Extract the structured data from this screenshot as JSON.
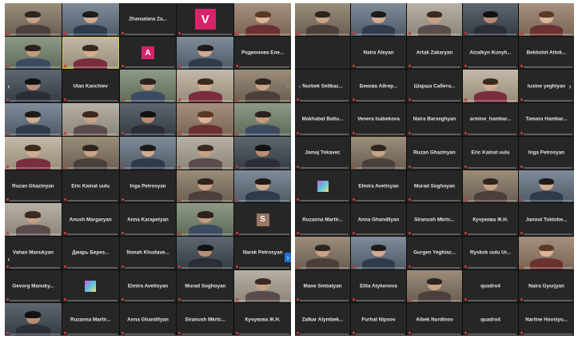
{
  "left_panel": {
    "tiles": [
      {
        "type": "video"
      },
      {
        "type": "video"
      },
      {
        "type": "name",
        "name": "Zhanadana Za..."
      },
      {
        "type": "avatar",
        "letter": "V",
        "color": "#d6246a",
        "big": true
      },
      {
        "type": "video"
      },
      {
        "type": "video"
      },
      {
        "type": "video",
        "active": true
      },
      {
        "type": "avatar",
        "letter": "A",
        "color": "#d6246a"
      },
      {
        "type": "video"
      },
      {
        "type": "name",
        "name": "Родионова Еле..."
      },
      {
        "type": "video"
      },
      {
        "type": "name",
        "name": "Ulan Kanchiev"
      },
      {
        "type": "video"
      },
      {
        "type": "video"
      },
      {
        "type": "video"
      },
      {
        "type": "video"
      },
      {
        "type": "video"
      },
      {
        "type": "video"
      },
      {
        "type": "video"
      },
      {
        "type": "video"
      },
      {
        "type": "video"
      },
      {
        "type": "video"
      },
      {
        "type": "video"
      },
      {
        "type": "video"
      },
      {
        "type": "video"
      },
      {
        "type": "name",
        "name": "Ruzan Ghazinyan"
      },
      {
        "type": "name",
        "name": "Eric Kainat uulu"
      },
      {
        "type": "name",
        "name": "Inga Petrosyan"
      },
      {
        "type": "video"
      },
      {
        "type": "video"
      },
      {
        "type": "video"
      },
      {
        "type": "name",
        "name": "Anush Margaryan"
      },
      {
        "type": "name",
        "name": "Anna Karapetyan"
      },
      {
        "type": "video"
      },
      {
        "type": "avatar",
        "letter": "S",
        "color": "#9a7666"
      },
      {
        "type": "name",
        "name": "Vahan Manukyan"
      },
      {
        "type": "name",
        "name": "Дмарь Берез..."
      },
      {
        "type": "name",
        "name": "Nonah Khudave..."
      },
      {
        "type": "video"
      },
      {
        "type": "name",
        "name": "Narek Petrosyan"
      },
      {
        "type": "name",
        "name": "Gevorg Manuky..."
      },
      {
        "type": "logo"
      },
      {
        "type": "name",
        "name": "Elmira Avetisyan"
      },
      {
        "type": "name",
        "name": "Murad Soghoyan"
      },
      {
        "type": "video"
      },
      {
        "type": "video"
      },
      {
        "type": "name",
        "name": "Ruzanna Martir..."
      },
      {
        "type": "name",
        "name": "Anna Ghandilyan"
      },
      {
        "type": "name",
        "name": "Siranush Mkrtc..."
      },
      {
        "type": "name",
        "name": "Кучукова Ж.Н."
      }
    ]
  },
  "right_panel": {
    "tiles": [
      {
        "type": "video"
      },
      {
        "type": "video"
      },
      {
        "type": "video"
      },
      {
        "type": "video"
      },
      {
        "type": "video"
      },
      {
        "type": "blank"
      },
      {
        "type": "name",
        "name": "Naira Aleyan"
      },
      {
        "type": "name",
        "name": "Artak Zakaryan"
      },
      {
        "type": "name",
        "name": "Aizalkyn Kunyh..."
      },
      {
        "type": "name",
        "name": "Bekbolot Attok..."
      },
      {
        "type": "name",
        "name": "Nurbek Seitkaz..."
      },
      {
        "type": "name",
        "name": "Бекова Айгер..."
      },
      {
        "type": "name",
        "name": "Шарша Сабета..."
      },
      {
        "type": "video"
      },
      {
        "type": "name",
        "name": "lusine yeghiyan"
      },
      {
        "type": "name",
        "name": "Makhabat Baitu..."
      },
      {
        "type": "name",
        "name": "Venera Isabekova"
      },
      {
        "type": "name",
        "name": "Naira Barseghyan"
      },
      {
        "type": "name",
        "name": "armine_hambar..."
      },
      {
        "type": "name",
        "name": "Tamara Hambar..."
      },
      {
        "type": "name",
        "name": "Jamaj Tokavec"
      },
      {
        "type": "video"
      },
      {
        "type": "name",
        "name": "Ruzan Ghazinyan"
      },
      {
        "type": "name",
        "name": "Eric Kainat uulu"
      },
      {
        "type": "name",
        "name": "Inga Petrosyan"
      },
      {
        "type": "logo"
      },
      {
        "type": "name",
        "name": "Elmira Avetisyan"
      },
      {
        "type": "name",
        "name": "Murad Soghoyan"
      },
      {
        "type": "video"
      },
      {
        "type": "video"
      },
      {
        "type": "name",
        "name": "Ruzanna Martir..."
      },
      {
        "type": "name",
        "name": "Anna Ghandilyan"
      },
      {
        "type": "name",
        "name": "Siranush Mkrtc..."
      },
      {
        "type": "name",
        "name": "Кучукова Ж.Н."
      },
      {
        "type": "name",
        "name": "Janout Toktobe..."
      },
      {
        "type": "video"
      },
      {
        "type": "video"
      },
      {
        "type": "name",
        "name": "Gurgen Yeghiaz..."
      },
      {
        "type": "name",
        "name": "Ryskok uulu Ur..."
      },
      {
        "type": "video"
      },
      {
        "type": "name",
        "name": "Mane Smbatyan"
      },
      {
        "type": "name",
        "name": "Elita Atykenova"
      },
      {
        "type": "video"
      },
      {
        "type": "name",
        "name": "quadro4"
      },
      {
        "type": "name",
        "name": "Naira Gyurjyan"
      },
      {
        "type": "name",
        "name": "Zalkar Alymbek..."
      },
      {
        "type": "name",
        "name": "Furhat Nipsov"
      },
      {
        "type": "name",
        "name": "Aibek Nurdinov"
      },
      {
        "type": "name",
        "name": "quadro4"
      },
      {
        "type": "name",
        "name": "Nariine Hovsiyu..."
      }
    ]
  },
  "nav": {
    "left_prev": "‹",
    "left_prev_row6": "‹",
    "left_next": "›",
    "left_next_row6": "›",
    "right_prev": "‹",
    "right_next": "›"
  }
}
